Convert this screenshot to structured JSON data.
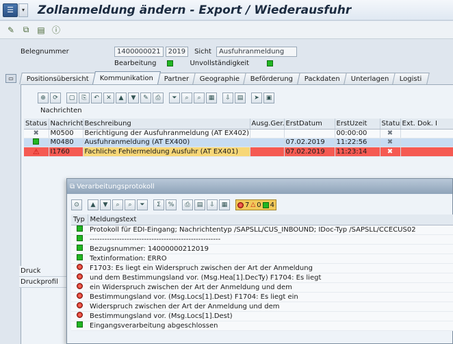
{
  "window": {
    "title": "Zollanmeldung ändern - Export / Wiederausfuhr"
  },
  "header": {
    "belegnummer_label": "Belegnummer",
    "belegnummer_value": "1400000021",
    "year_value": "2019",
    "sicht_label": "Sicht",
    "sicht_value": "Ausfuhranmeldung",
    "bearbeitung_label": "Bearbeitung",
    "unvollstaendigkeit_label": "Unvollständigkeit"
  },
  "tabs": [
    {
      "label": "Positionsübersicht"
    },
    {
      "label": "Kommunikation"
    },
    {
      "label": "Partner"
    },
    {
      "label": "Geographie"
    },
    {
      "label": "Beförderung"
    },
    {
      "label": "Packdaten"
    },
    {
      "label": "Unterlagen"
    },
    {
      "label": "Logisti"
    }
  ],
  "messages": {
    "section_title": "Nachrichten",
    "columns": [
      "Status",
      "Nachricht",
      "Beschreibung",
      "Ausg.Ger.",
      "ErstDatum",
      "ErstUzeit",
      "Status",
      "Ext. Dok. I"
    ],
    "rows": [
      {
        "nachricht": "M0500",
        "beschreibung": "Berichtigung der Ausfuhranmeldung (AT EX402)",
        "ausg": "",
        "datum": "",
        "zeit": "00:00:00"
      },
      {
        "nachricht": "M0480",
        "beschreibung": "Ausfuhranmeldung (AT EX400)",
        "ausg": "",
        "datum": "07.02.2019",
        "zeit": "11:22:56"
      },
      {
        "nachricht": "I1760",
        "beschreibung": "Fachliche Fehlermeldung Ausfuhr (AT EX401)",
        "ausg": "",
        "datum": "07.02.2019",
        "zeit": "11:23:14"
      }
    ]
  },
  "lower_left": {
    "items": [
      "Druck",
      "Druckprofil"
    ]
  },
  "popup": {
    "title": "Verarbeitungsprotokoll",
    "counts": {
      "red": "7",
      "yellow": "0",
      "green": "4"
    },
    "columns": {
      "typ": "Typ",
      "text": "Meldungstext"
    },
    "rows": [
      {
        "type": "green",
        "text": "Protokoll für EDI-Eingang; Nachrichtentyp /SAPSLL/CUS_INBOUND; IDoc-Typ /SAPSLL/CCECUS02"
      },
      {
        "type": "green",
        "text": "-----------------------------------------------------"
      },
      {
        "type": "green",
        "text": "Bezugsnummer: 14000000212019"
      },
      {
        "type": "green",
        "text": "Textinformation:  ERRO"
      },
      {
        "type": "red",
        "text": "F1703: Es liegt ein Widerspruch zwischen der Art der Anmeldung"
      },
      {
        "type": "red",
        "text": "und dem Bestimmungsland vor. (Msg.Hea[1].DecTy) F1704: Es liegt"
      },
      {
        "type": "red",
        "text": "ein Widerspruch zwischen der Art der Anmeldung und dem"
      },
      {
        "type": "red",
        "text": "Bestimmungsland vor. (Msg.Locs[1].Dest) F1704: Es liegt ein"
      },
      {
        "type": "red",
        "text": "Widerspruch zwischen der Art der Anmeldung und dem"
      },
      {
        "type": "red",
        "text": "Bestimmungsland vor. (Msg.Locs[1].Dest)"
      },
      {
        "type": "green",
        "text": "Eingangsverarbeitung abgeschlossen"
      }
    ]
  }
}
